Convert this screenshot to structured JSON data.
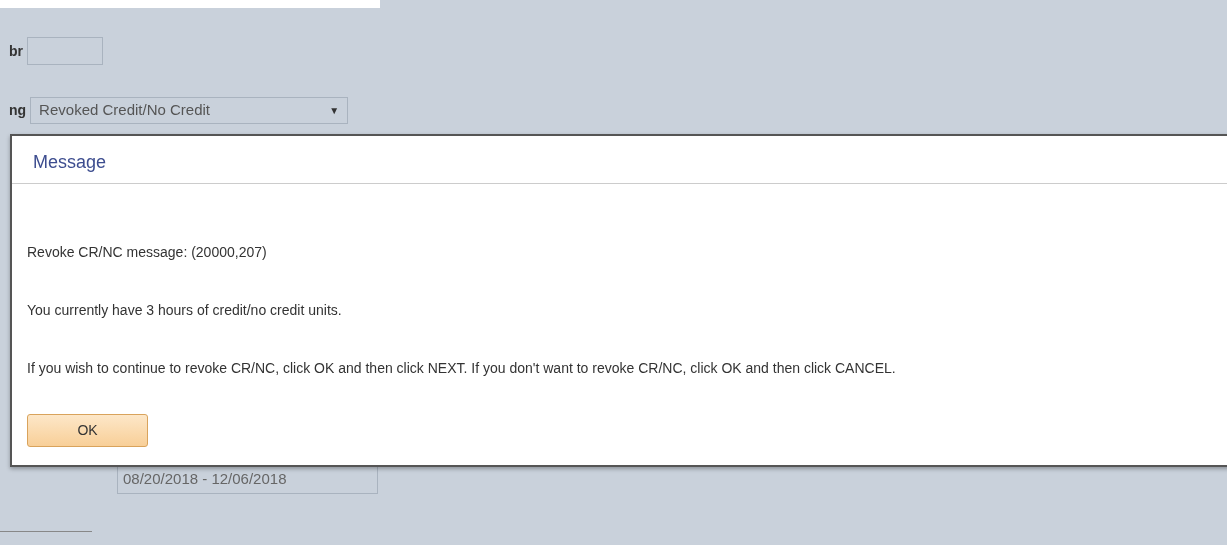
{
  "form": {
    "number_label": "br",
    "dropdown_arrow": "▼",
    "grading_label": "ng",
    "grading_value": "Revoked Credit/No Credit",
    "dates": "08/20/2018 - 12/06/2018"
  },
  "dialog": {
    "title": "Message",
    "paragraphs": [
      "Revoke CR/NC message: (20000,207)",
      "You currently have 3 hours of credit/no credit units.",
      "If you wish to continue to revoke CR/NC, click OK and then click NEXT. If you don't want to revoke CR/NC, click OK and then click CANCEL."
    ],
    "buttons": [
      "OK"
    ]
  }
}
